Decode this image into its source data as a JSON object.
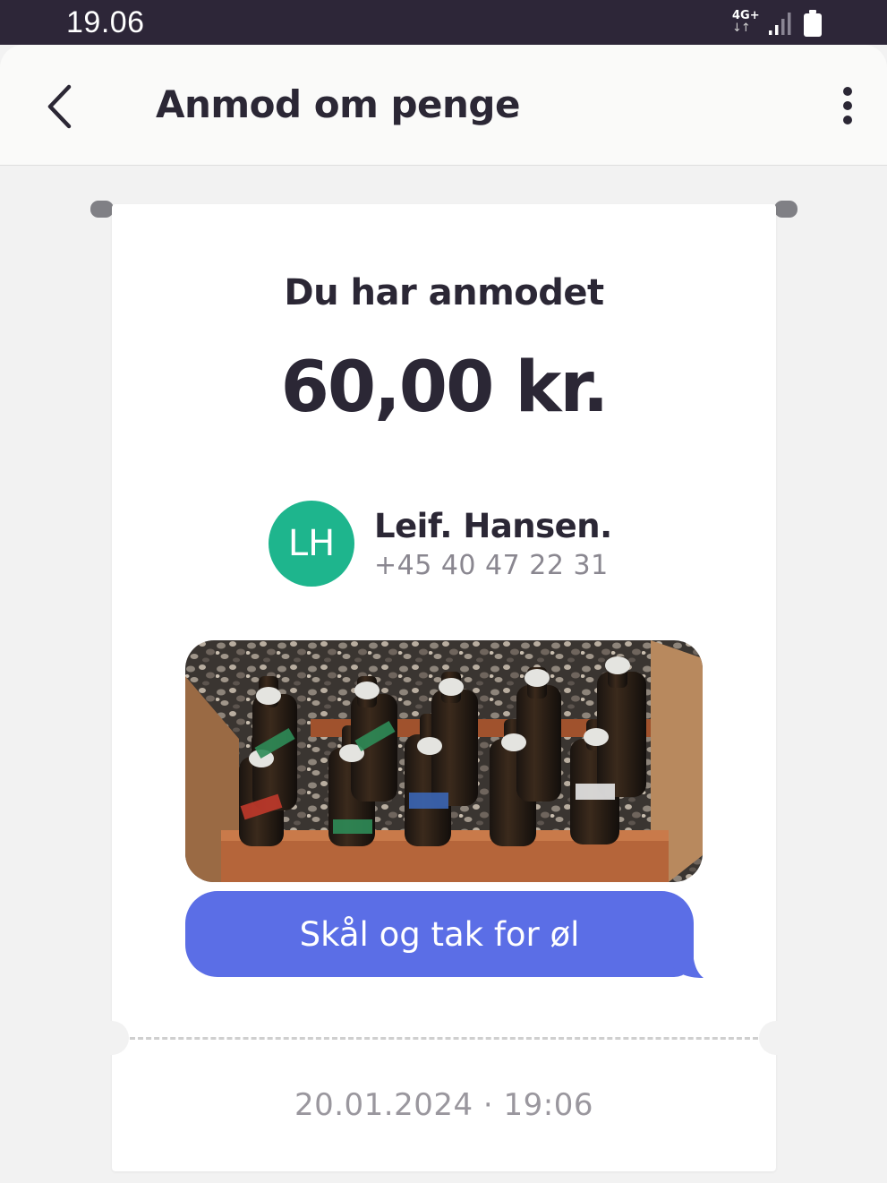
{
  "status_bar": {
    "time": "19.06",
    "network": "4G+",
    "network_arrows": "↓↑",
    "signal_icon": "signal-bars-icon",
    "battery_icon": "battery-icon"
  },
  "app_bar": {
    "back_icon": "chevron-left-icon",
    "title": "Anmod om penge",
    "menu_icon": "more-vertical-icon"
  },
  "receipt": {
    "headline": "Du har anmodet",
    "amount": "60,00 kr.",
    "contact": {
      "initials": "LH",
      "name": "Leif. Hansen.",
      "phone": "+45 40 47 22 31",
      "avatar_color": "#1eb58d"
    },
    "message": "Skål og tak for øl",
    "message_color": "#5b6ee6",
    "timestamp": "20.01.2024 · 19:06"
  }
}
